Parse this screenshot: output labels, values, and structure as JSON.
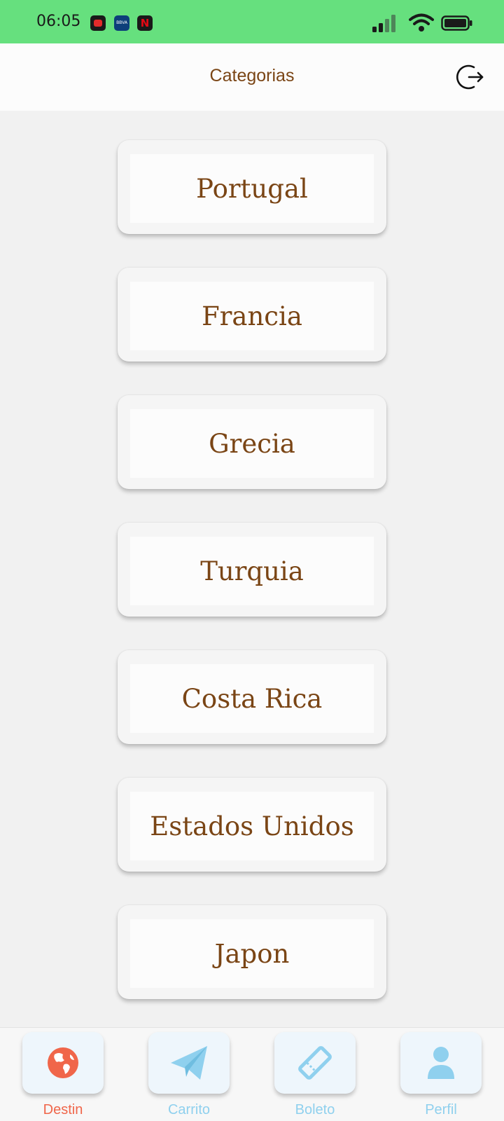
{
  "status_bar": {
    "time": "06:05",
    "notification_icons": [
      "youtube-icon",
      "bbva-icon",
      "netflix-icon"
    ],
    "bbva_text": "BBVA"
  },
  "header": {
    "title": "Categorias",
    "logout_icon": "logout-icon"
  },
  "categories": [
    {
      "label": "Portugal"
    },
    {
      "label": "Francia"
    },
    {
      "label": "Grecia"
    },
    {
      "label": "Turquia"
    },
    {
      "label": "Costa Rica"
    },
    {
      "label": "Estados Unidos"
    },
    {
      "label": "Japon"
    }
  ],
  "bottom_nav": {
    "items": [
      {
        "label": "Destin",
        "icon": "globe-icon",
        "active": true
      },
      {
        "label": "Carrito",
        "icon": "paper-plane-icon",
        "active": false
      },
      {
        "label": "Boleto",
        "icon": "ticket-icon",
        "active": false
      },
      {
        "label": "Perfil",
        "icon": "person-icon",
        "active": false
      }
    ]
  },
  "colors": {
    "status_bar": "#66e07e",
    "brown_text": "#7a4515",
    "active_nav": "#f0664a",
    "inactive_nav": "#8fd0ee",
    "background": "#f1f1f1"
  }
}
